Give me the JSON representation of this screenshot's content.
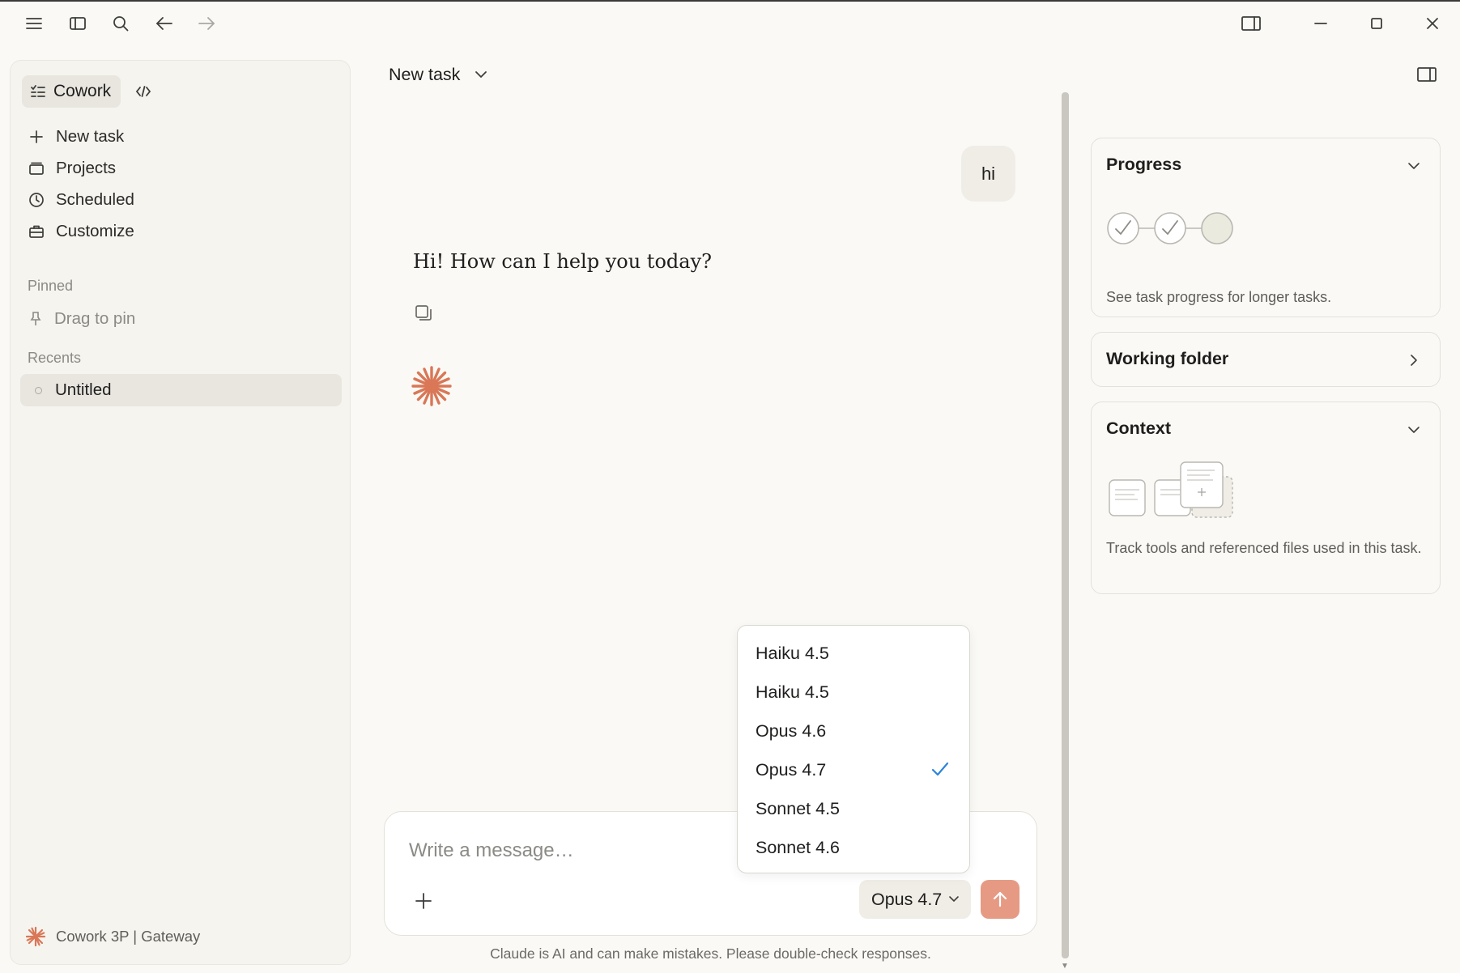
{
  "sidebar": {
    "mode_label": "Cowork",
    "nav": [
      {
        "label": "New task",
        "icon": "plus-icon"
      },
      {
        "label": "Projects",
        "icon": "folder-icon"
      },
      {
        "label": "Scheduled",
        "icon": "clock-icon"
      },
      {
        "label": "Customize",
        "icon": "briefcase-icon"
      }
    ],
    "pinned_label": "Pinned",
    "pin_hint": "Drag to pin",
    "recents_label": "Recents",
    "recents": [
      {
        "label": "Untitled"
      }
    ],
    "footer_label": "Cowork 3P | Gateway"
  },
  "header": {
    "task_title": "New task"
  },
  "chat": {
    "user_message": "hi",
    "assistant_message": "Hi! How can I help you today?"
  },
  "composer": {
    "placeholder": "Write a message…",
    "selected_model": "Opus 4.7",
    "disclaimer": "Claude is AI and can make mistakes. Please double-check responses."
  },
  "model_dropdown": {
    "options": [
      "Haiku 4.5",
      "Haiku 4.5",
      "Opus 4.6",
      "Opus 4.7",
      "Sonnet 4.5",
      "Sonnet 4.6"
    ],
    "selected": "Opus 4.7"
  },
  "right_panel": {
    "progress": {
      "title": "Progress",
      "description": "See task progress for longer tasks."
    },
    "working_folder": {
      "title": "Working folder"
    },
    "context": {
      "title": "Context",
      "description": "Track tools and referenced files used in this task."
    }
  },
  "colors": {
    "accent": "#d97757",
    "send_button": "#e69a84",
    "check": "#2c84db",
    "background": "#faf9f5"
  }
}
